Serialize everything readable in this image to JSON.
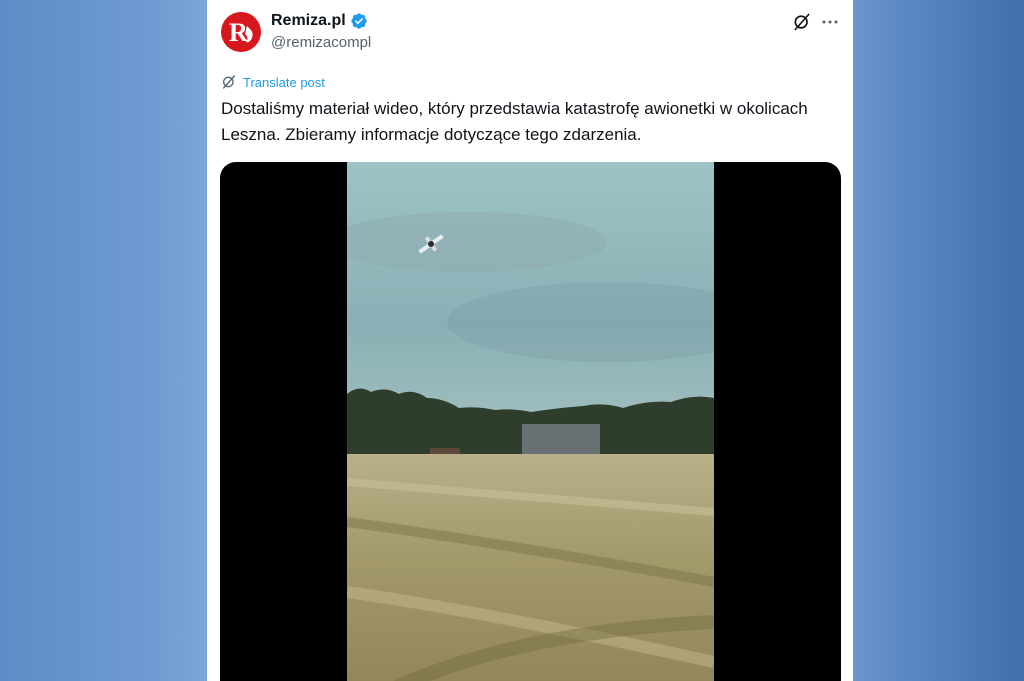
{
  "account": {
    "display_name": "Remiza.pl",
    "handle": "@remizacompl",
    "verified": true,
    "avatar_letter": "R",
    "brand_color": "#d6171d"
  },
  "actions": {
    "grok_icon": "grok-icon",
    "more_icon": "more-icon"
  },
  "translate": {
    "label": "Translate post"
  },
  "post": {
    "text": "Dostaliśmy materiał wideo, który przedstawia katastrofę awionetki w okolicach Leszna. Zbieramy informacje dotyczące tego zdarzenia."
  },
  "media": {
    "type": "video"
  },
  "colors": {
    "link": "#1d9bf0",
    "text": "#0f1419",
    "secondary": "#536471"
  }
}
